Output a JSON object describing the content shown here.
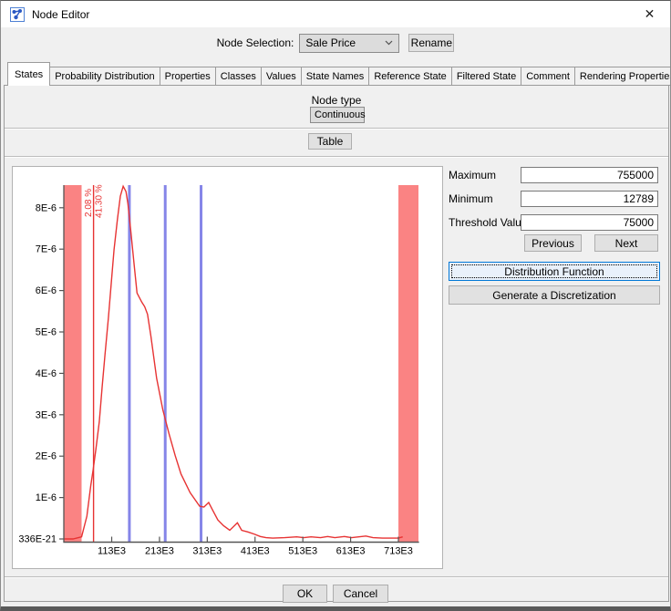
{
  "window": {
    "title": "Node Editor",
    "close_glyph": "✕"
  },
  "toolbar": {
    "node_selection_label": "Node Selection:",
    "node_selector_value": "Sale Price",
    "rename_button": "Rename"
  },
  "tabs": {
    "active_index": 0,
    "items": [
      "States",
      "Probability Distribution",
      "Properties",
      "Classes",
      "Values",
      "State Names",
      "Reference State",
      "Filtered State",
      "Comment",
      "Rendering Properties"
    ]
  },
  "node_type": {
    "label": "Node type",
    "value": "Continuous"
  },
  "table_button": "Table",
  "controls": {
    "maximum_label": "Maximum",
    "maximum_value": "755000",
    "minimum_label": "Minimum",
    "minimum_value": "12789",
    "threshold_label": "Threshold Value",
    "threshold_value": "75000",
    "previous_button": "Previous",
    "next_button": "Next",
    "distribution_function_button": "Distribution Function",
    "generate_discretization_button": "Generate a Discretization"
  },
  "footer": {
    "ok_button": "OK",
    "cancel_button": "Cancel"
  },
  "colors": {
    "focus_accent": "#0078d7",
    "censored_band": "#fa8383",
    "curve_red": "#e73333",
    "discretization_blue": "#8585e8",
    "axis_gray": "#555555"
  },
  "chart_data": {
    "type": "line",
    "title": "",
    "xlabel": "",
    "ylabel": "",
    "grid": false,
    "legend": null,
    "x_axis": {
      "min": 12789,
      "max": 755000,
      "tick_values": [
        113000,
        213000,
        313000,
        413000,
        513000,
        613000,
        713000
      ],
      "tick_labels": [
        "113E3",
        "213E3",
        "313E3",
        "413E3",
        "513E3",
        "613E3",
        "713E3"
      ]
    },
    "y_axis": {
      "min": 0,
      "max": 8.6e-06,
      "tick_values": [
        8e-06,
        7e-06,
        6e-06,
        5e-06,
        4e-06,
        3e-06,
        2e-06,
        1e-06,
        0
      ],
      "tick_labels": [
        "8E-6",
        "7E-6",
        "6E-6",
        "5E-6",
        "4E-6",
        "3E-6",
        "2E-6",
        "1E-6",
        "336E-21"
      ]
    },
    "censored_bands": [
      [
        12789,
        50000
      ],
      [
        713000,
        755000
      ]
    ],
    "discretization_lines": [
      150000,
      225000,
      300000
    ],
    "threshold_line": {
      "value": 75000,
      "labels": [
        "2.08 %",
        "41.30 %"
      ]
    },
    "density_curve": [
      [
        13000,
        0
      ],
      [
        32000,
        0
      ],
      [
        50000,
        5e-08
      ],
      [
        61000,
        5.5e-07
      ],
      [
        69000,
        1.28e-06
      ],
      [
        74000,
        1.66e-06
      ],
      [
        80000,
        2.17e-06
      ],
      [
        87000,
        2.83e-06
      ],
      [
        93000,
        3.66e-06
      ],
      [
        99000,
        4.46e-06
      ],
      [
        106000,
        5.34e-06
      ],
      [
        112000,
        6.17e-06
      ],
      [
        118000,
        6.99e-06
      ],
      [
        125000,
        7.72e-06
      ],
      [
        131000,
        8.28e-06
      ],
      [
        137000,
        8.52e-06
      ],
      [
        143000,
        8.39e-06
      ],
      [
        147000,
        8.1e-06
      ],
      [
        153000,
        7.43e-06
      ],
      [
        160000,
        6.61e-06
      ],
      [
        166000,
        5.94e-06
      ],
      [
        176000,
        5.72e-06
      ],
      [
        182000,
        5.61e-06
      ],
      [
        188000,
        5.43e-06
      ],
      [
        195000,
        4.9e-06
      ],
      [
        207000,
        3.88e-06
      ],
      [
        220000,
        3.12e-06
      ],
      [
        233000,
        2.54e-06
      ],
      [
        246000,
        2.01e-06
      ],
      [
        258000,
        1.57e-06
      ],
      [
        277000,
        1.12e-06
      ],
      [
        297000,
        7.9e-07
      ],
      [
        306000,
        7.7e-07
      ],
      [
        316000,
        8.8e-07
      ],
      [
        325000,
        6.8e-07
      ],
      [
        335000,
        4.6e-07
      ],
      [
        347000,
        3.2e-07
      ],
      [
        360000,
        2.1e-07
      ],
      [
        376000,
        3.9e-07
      ],
      [
        385000,
        2.1e-07
      ],
      [
        398000,
        1.7e-07
      ],
      [
        411000,
        1.2e-07
      ],
      [
        424000,
        6e-08
      ],
      [
        436000,
        3e-08
      ],
      [
        450000,
        2e-08
      ],
      [
        475000,
        3e-08
      ],
      [
        500000,
        5e-08
      ],
      [
        515000,
        3e-08
      ],
      [
        530000,
        5e-08
      ],
      [
        550000,
        3e-08
      ],
      [
        565000,
        6e-08
      ],
      [
        580000,
        3e-08
      ],
      [
        600000,
        6e-08
      ],
      [
        615000,
        3e-08
      ],
      [
        630000,
        5e-08
      ],
      [
        645000,
        7e-08
      ],
      [
        660000,
        3e-08
      ],
      [
        680000,
        2e-08
      ],
      [
        700000,
        2e-08
      ],
      [
        713000,
        2e-08
      ],
      [
        722000,
        5e-08
      ]
    ]
  }
}
